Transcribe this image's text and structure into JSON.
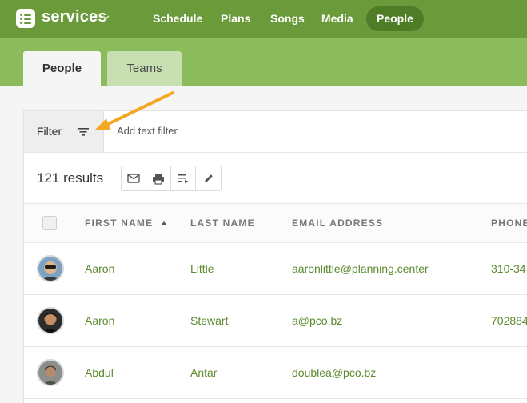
{
  "app": {
    "name": "services"
  },
  "nav": {
    "items": [
      "Schedule",
      "Plans",
      "Songs",
      "Media",
      "People"
    ],
    "active": "People"
  },
  "tabs": {
    "people": "People",
    "teams": "Teams"
  },
  "filter": {
    "label": "Filter",
    "placeholder": "Add text filter"
  },
  "results": {
    "count_label": "121 results"
  },
  "table": {
    "columns": [
      "FIRST NAME",
      "LAST NAME",
      "EMAIL ADDRESS",
      "PHONE"
    ],
    "rows": [
      {
        "first": "Aaron",
        "last": "Little",
        "email": "aaronlittle@planning.center",
        "phone": "310-34"
      },
      {
        "first": "Aaron",
        "last": "Stewart",
        "email": "a@pco.bz",
        "phone": "702884"
      },
      {
        "first": "Abdul",
        "last": "Antar",
        "email": "doublea@pco.bz",
        "phone": ""
      }
    ]
  },
  "colors": {
    "nav_bg": "#6a9a3a",
    "tab_bar": "#8cbb5b",
    "link_green": "#5c8a2e",
    "arrow": "#f5a623"
  },
  "icons": [
    "list-icon",
    "chevron-down-icon",
    "filter-icon",
    "mail-icon",
    "print-icon",
    "playlist-icon",
    "pencil-icon",
    "sort-asc-icon"
  ]
}
